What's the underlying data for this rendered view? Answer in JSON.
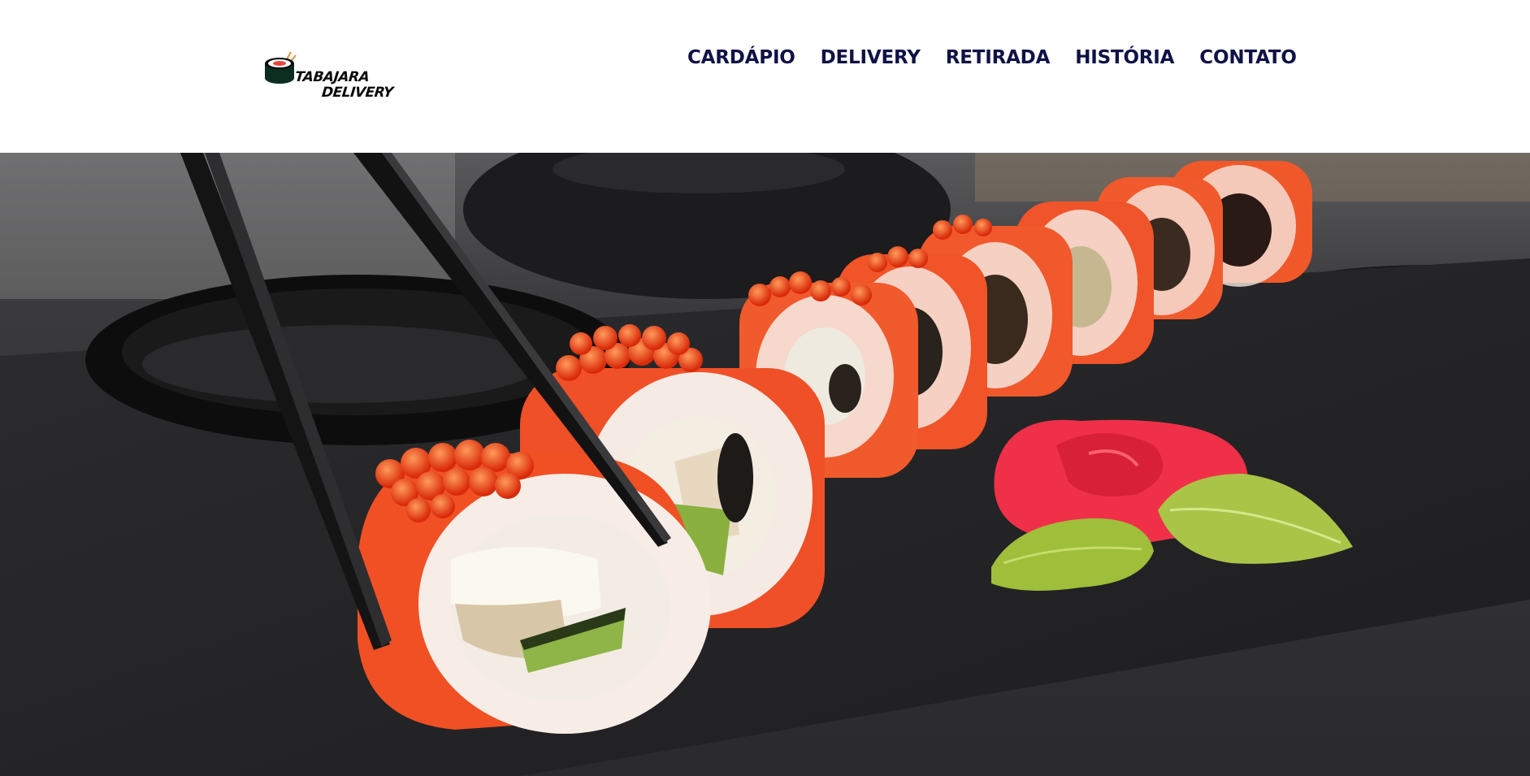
{
  "brand": {
    "line1": "TABAJARA",
    "line2": "DELIVERY",
    "logo_icon": "sushi-roll-chopsticks-icon"
  },
  "nav": {
    "items": [
      {
        "label": "CARDÁPIO"
      },
      {
        "label": "DELIVERY"
      },
      {
        "label": "RETIRADA"
      },
      {
        "label": "HISTÓRIA"
      },
      {
        "label": "CONTATO"
      }
    ]
  },
  "colors": {
    "nav_text": "#0e1245",
    "header_bg": "#ffffff",
    "salmon": "#f2562a",
    "slate": "#262628"
  },
  "hero": {
    "image_subject": "salmon sushi rolls with chopsticks on slate"
  }
}
